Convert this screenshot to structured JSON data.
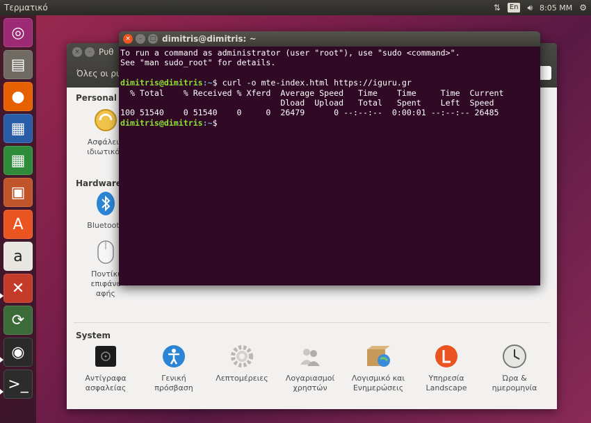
{
  "top_panel": {
    "app_title": "Τερματικό",
    "keyboard_layout": "En",
    "clock": "8:05 ΜΜ"
  },
  "launcher": {
    "items": [
      {
        "name": "dash",
        "icon": "ubuntu-logo-icon",
        "color": "#9d2a74"
      },
      {
        "name": "files",
        "icon": "files-icon",
        "color": "#6f6b63"
      },
      {
        "name": "firefox",
        "icon": "firefox-icon",
        "color": "#e66000"
      },
      {
        "name": "writer",
        "icon": "libreoffice-writer-icon",
        "color": "#2a5da8"
      },
      {
        "name": "calc",
        "icon": "libreoffice-calc-icon",
        "color": "#2e8b3a"
      },
      {
        "name": "impress",
        "icon": "libreoffice-impress-icon",
        "color": "#c0542a"
      },
      {
        "name": "software",
        "icon": "software-center-icon",
        "color": "#e95420"
      },
      {
        "name": "amazon",
        "icon": "amazon-icon",
        "color": "#c8c5bf"
      },
      {
        "name": "system-settings",
        "icon": "settings-icon",
        "color": "#c53b2a"
      },
      {
        "name": "updater",
        "icon": "software-updater-icon",
        "color": "#3c6b3a"
      },
      {
        "name": "backups",
        "icon": "backups-icon",
        "color": "#2a2a2a"
      },
      {
        "name": "terminal",
        "icon": "terminal-icon",
        "color": "#2c2c2c"
      }
    ]
  },
  "settings": {
    "title": "Ρυθ",
    "all_settings": "Όλες οι ρυ",
    "sections": {
      "personal": "Personal",
      "hardware": "Hardware",
      "system": "System"
    },
    "personal_items": [
      {
        "line1": "Ασφάλεια",
        "line2": "ιδιωτικότ"
      }
    ],
    "hardware_items": [
      {
        "line1": "Bluetooth",
        "line2": ""
      },
      {
        "line1": "Ποντίκι",
        "line2": "επιφάνε",
        "line3": "αφής"
      }
    ],
    "system_items": [
      {
        "line1": "Αντίγραφα",
        "line2": "ασφαλείας",
        "icon": "backups-icon"
      },
      {
        "line1": "Γενική",
        "line2": "πρόσβαση",
        "icon": "accessibility-icon"
      },
      {
        "line1": "Λεπτομέρειες",
        "line2": "",
        "icon": "gear-icon"
      },
      {
        "line1": "Λογαριασμοί",
        "line2": "χρηστών",
        "icon": "users-icon"
      },
      {
        "line1": "Λογισμικό και",
        "line2": "Ενημερώσεις",
        "icon": "software-updates-icon"
      },
      {
        "line1": "Υπηρεσία",
        "line2": "Landscape",
        "icon": "landscape-icon"
      },
      {
        "line1": "Ώρα &",
        "line2": "ημερομηνία",
        "icon": "clock-icon"
      }
    ]
  },
  "terminal": {
    "title": "dimitris@dimitris: ~",
    "line1": "To run a command as administrator (user \"root\"), use \"sudo <command>\".",
    "line2": "See \"man sudo_root\" for details.",
    "prompt_user": "dimitris@dimitris",
    "prompt_path": ":~",
    "prompt_sym": "$ ",
    "command": "curl -o mte-index.html https://iguru.gr",
    "header1": "  % Total    % Received % Xferd  Average Speed   Time    Time     Time  Current",
    "header2": "                                 Dload  Upload   Total   Spent    Left  Speed",
    "progress": "100 51540    0 51540    0     0  26479      0 --:--:--  0:00:01 --:--:-- 26485",
    "prompt2_sym": "$"
  }
}
